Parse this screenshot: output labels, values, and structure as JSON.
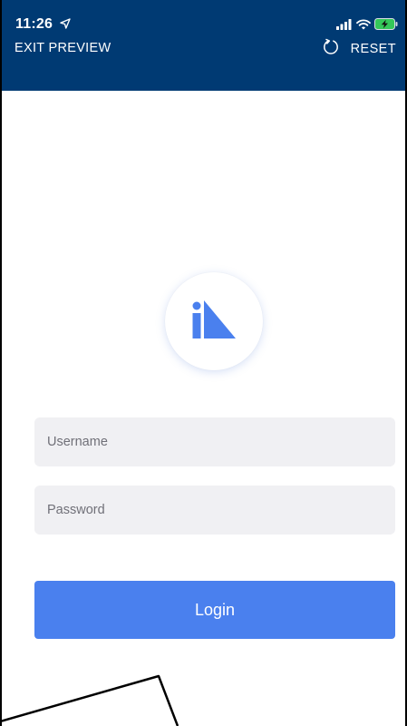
{
  "status_bar": {
    "time": "11:26",
    "icons": [
      "location-arrow-icon",
      "signal-bars-icon",
      "wifi-icon",
      "battery-charging-icon"
    ]
  },
  "header": {
    "exit_label": "EXIT PREVIEW",
    "reset_label": "RESET",
    "reset_icon": "refresh-icon",
    "background_color": "#003a73"
  },
  "logo": {
    "icon": "app-logo-icon",
    "color": "#4a80ee"
  },
  "form": {
    "username_placeholder": "Username",
    "password_placeholder": "Password",
    "login_label": "Login",
    "accent_color": "#4a80ee"
  }
}
